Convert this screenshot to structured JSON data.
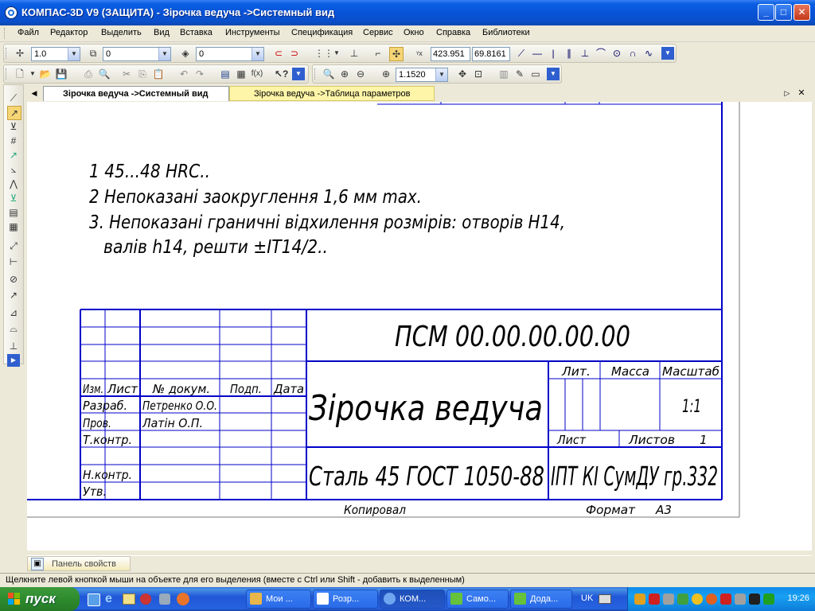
{
  "window": {
    "title": "КОМПАС-3D V9 (ЗАЩИТА) - Зірочка ведуча ->Системный вид",
    "controls": {
      "minimize": "_",
      "maximize": "□",
      "close": "✕"
    }
  },
  "menu": [
    "Файл",
    "Редактор",
    "Выделить",
    "Вид",
    "Вставка",
    "Инструменты",
    "Спецификация",
    "Сервис",
    "Окно",
    "Справка",
    "Библиотеки"
  ],
  "toolbar_current": {
    "scale": "1.0",
    "layer": "0",
    "style": "0",
    "coord_x": "423.951",
    "coord_y": "69.8161"
  },
  "toolbar_standard": {
    "zoom": "1.1520"
  },
  "tabs": [
    {
      "label": "Зірочка ведуча ->Системный вид",
      "active": true
    },
    {
      "label": "Зірочка ведуча ->Таблица параметров",
      "active": false
    }
  ],
  "drawing": {
    "notes": [
      "1  45...48 HRC..",
      "2 Непоказані заокруглення 1,6 мм max.",
      "3. Непоказані граничні відхилення розмірів: отворів H14,",
      "валів h14, решти ±IT14/2.."
    ],
    "title_block": {
      "designation": "ПСМ 00.00.00.00.00",
      "name": "Зірочка ведуча",
      "material": "Сталь 45 ГОСТ 1050-88",
      "organization": "ІПТ КІ СумДУ гр.332",
      "col_izm": "Изм.",
      "col_list": "Лист",
      "col_docum": "№ докум.",
      "col_podp": "Подп.",
      "col_data": "Дата",
      "role_razrab": "Разраб.",
      "role_prov": "Пров.",
      "role_tkontr": "Т.контр.",
      "role_nkontr": "Н.контр.",
      "role_utv": "Утв.",
      "person_razrab": "Петренко О.О.",
      "person_prov": "Латін О.П.",
      "lit": "Лит.",
      "massa": "Масса",
      "masshtab": "Масштаб",
      "scale_value": "1:1",
      "sheet_label": "Лист",
      "sheets_label": "Листов",
      "sheets_value": "1"
    },
    "footer": {
      "copied": "Копировал",
      "format_label": "Формат",
      "format_value": "А3"
    }
  },
  "properties_panel": {
    "tab": "Панель свойств"
  },
  "status": "Щелкните левой кнопкой мыши на объекте для его выделения (вместе с Ctrl или Shift - добавить к выделенным)",
  "taskbar": {
    "start": "пуск",
    "tasks": [
      {
        "label": "Мои ...",
        "active": false,
        "color": "#E8B64A"
      },
      {
        "label": "Розр...",
        "active": false,
        "color": "#FFFFFF"
      },
      {
        "label": "КОМ...",
        "active": true,
        "color": "#6FA6F0"
      },
      {
        "label": "Само...",
        "active": false,
        "color": "#66C23A"
      },
      {
        "label": "Дода...",
        "active": false,
        "color": "#66C23A"
      }
    ],
    "lang": "UK",
    "clock": "19:26"
  },
  "colors": {
    "frame_blue": "#0000C8",
    "canvas": "#FFFFFF",
    "title_bar": "#0A5FE3"
  }
}
